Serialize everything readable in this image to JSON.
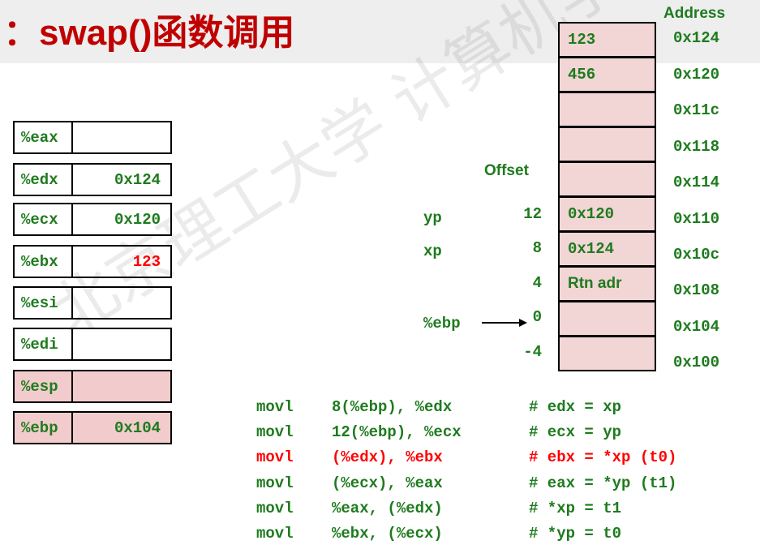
{
  "title": "：swap()函数调用",
  "watermark": "北京理工大学 计算机学院 高天",
  "registers": [
    {
      "name": "%eax",
      "value": ""
    },
    {
      "name": "%edx",
      "value": "0x124"
    },
    {
      "name": "%ecx",
      "value": "0x120"
    },
    {
      "name": "%ebx",
      "value": "123"
    },
    {
      "name": "%esi",
      "value": ""
    },
    {
      "name": "%edi",
      "value": ""
    },
    {
      "name": "%esp",
      "value": ""
    },
    {
      "name": "%ebp",
      "value": "0x104"
    }
  ],
  "stack": {
    "address_header": "Address",
    "offset_header": "Offset",
    "cells": [
      "123",
      "456",
      "",
      "",
      "",
      "0x120",
      "0x124",
      "Rtn adr",
      "",
      ""
    ],
    "addresses": [
      "0x124",
      "0x120",
      "0x11c",
      "0x118",
      "0x114",
      "0x110",
      "0x10c",
      "0x108",
      "0x104",
      "0x100"
    ],
    "offsets": [
      "12",
      "8",
      "4",
      "0",
      "-4"
    ],
    "labels": {
      "yp": "yp",
      "xp": "xp",
      "ebp": "%ebp"
    }
  },
  "code": [
    {
      "op": "movl",
      "args": "8(%ebp), %edx",
      "comment": "# edx = xp"
    },
    {
      "op": "movl",
      "args": "12(%ebp), %ecx",
      "comment": "# ecx = yp"
    },
    {
      "op": "movl",
      "args": "(%edx), %ebx",
      "comment": "# ebx = *xp (t0)"
    },
    {
      "op": "movl",
      "args": "(%ecx), %eax",
      "comment": "# eax = *yp (t1)"
    },
    {
      "op": "movl",
      "args": "%eax, (%edx)",
      "comment": "# *xp = t1"
    },
    {
      "op": "movl",
      "args": "%ebx, (%ecx)",
      "comment": "# *yp = t0"
    }
  ],
  "colors": {
    "title": "#c00000",
    "text": "#1e7b1e",
    "highlight": "#ff0000",
    "cell_fill": "#f2d5d5"
  }
}
